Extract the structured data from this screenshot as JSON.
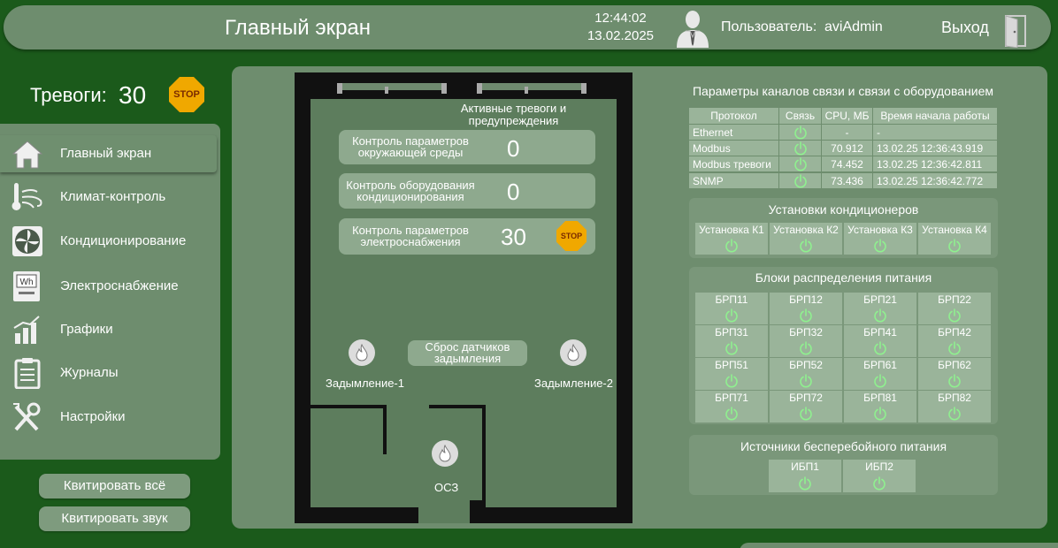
{
  "header": {
    "title": "Главный экран",
    "time": "12:44:02",
    "date": "13.02.2025",
    "user_label": "Пользователь:",
    "user_name": "aviAdmin",
    "logout_label": "Выход"
  },
  "alarms": {
    "label": "Тревоги:",
    "count": "30",
    "stop_label": "STOP"
  },
  "nav": {
    "items": [
      {
        "label": "Главный экран",
        "icon": "home-icon",
        "active": true
      },
      {
        "label": "Климат-контроль",
        "icon": "thermometer-wind-icon"
      },
      {
        "label": "Кондиционирование",
        "icon": "fan-icon"
      },
      {
        "label": "Электроснабжение",
        "icon": "power-meter-icon"
      },
      {
        "label": "Графики",
        "icon": "chart-icon"
      },
      {
        "label": "Журналы",
        "icon": "clipboard-icon"
      },
      {
        "label": "Настройки",
        "icon": "tools-icon"
      }
    ]
  },
  "actions": {
    "ack_all": "Квитировать всё",
    "ack_sound": "Квитировать звук"
  },
  "plan": {
    "active_title": "Активные тревоги и предупреждения",
    "env_label": "Контроль параметров окружающей среды",
    "env_count": "0",
    "ac_label": "Контроль оборудования кондиционирования",
    "ac_count": "0",
    "power_label": "Контроль параметров электроснабжения",
    "power_count": "30",
    "power_stop": "STOP",
    "smoke1": "Задымление-1",
    "smoke2": "Задымление-2",
    "reset_label": "Сброс датчиков задымления",
    "ocz": "ОСЗ"
  },
  "comms": {
    "title": "Параметры каналов связи и связи с оборудованием",
    "headers": [
      "Протокол",
      "Связь",
      "CPU, МБ",
      "Время начала работы"
    ],
    "rows": [
      {
        "protocol": "Ethernet",
        "cpu": "-",
        "time": "-"
      },
      {
        "protocol": "Modbus",
        "cpu": "70.912",
        "time": "13.02.25 12:36:43.919"
      },
      {
        "protocol": "Modbus тревоги",
        "cpu": "74.452",
        "time": "13.02.25 12:36:42.811"
      },
      {
        "protocol": "SNMP",
        "cpu": "73.436",
        "time": "13.02.25 12:36:42.772"
      }
    ]
  },
  "ac_units": {
    "title": "Установки кондиционеров",
    "items": [
      "Установка К1",
      "Установка К2",
      "Установка К3",
      "Установка К4"
    ]
  },
  "pdu": {
    "title": "Блоки распределения питания",
    "items": [
      "БРП11",
      "БРП12",
      "БРП21",
      "БРП22",
      "БРП31",
      "БРП32",
      "БРП41",
      "БРП42",
      "БРП51",
      "БРП52",
      "БРП61",
      "БРП62",
      "БРП71",
      "БРП72",
      "БРП81",
      "БРП82"
    ]
  },
  "ups": {
    "title": "Источники бесперебойного питания",
    "items": [
      "ИБП1",
      "ИБП2"
    ]
  },
  "colors": {
    "background": "#1b5a1b",
    "panel": "#6e8d6e",
    "cell": "#9ab49a",
    "power_ok": "#8ff08f",
    "stop": "#f0a800"
  }
}
